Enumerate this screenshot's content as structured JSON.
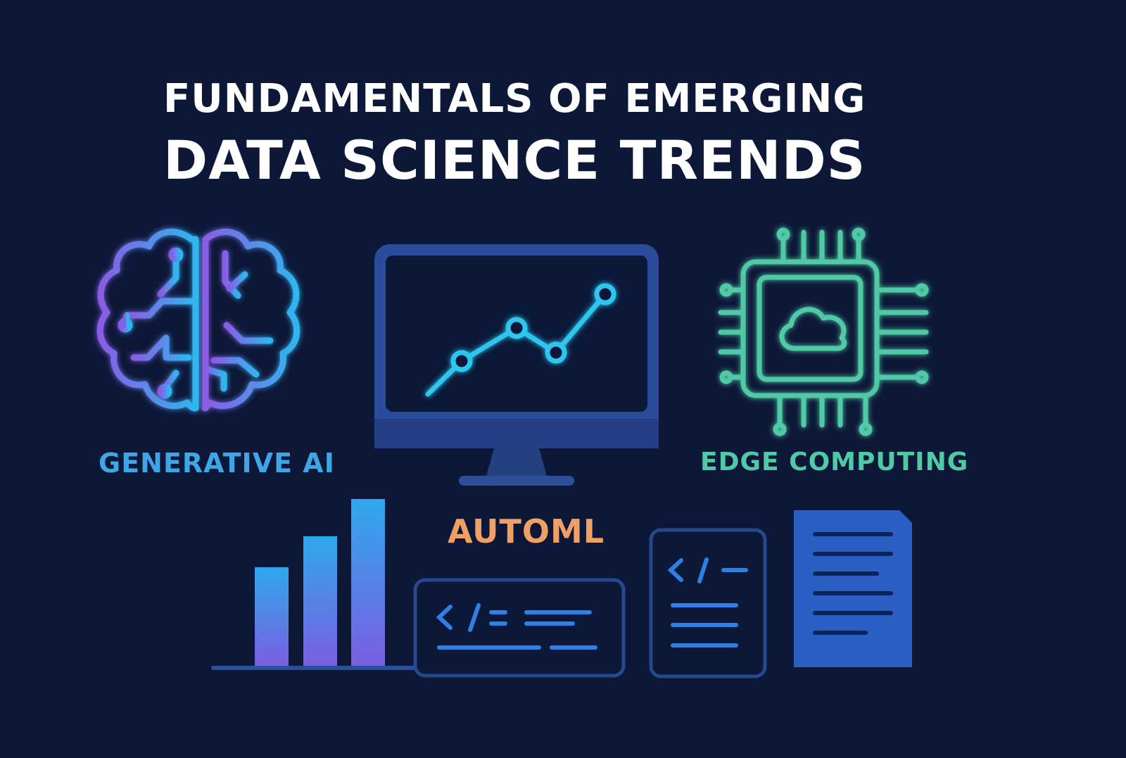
{
  "title": {
    "line1": "FUNDAMENTALS OF EMERGING",
    "line2": "DATA SCIENCE TRENDS"
  },
  "labels": {
    "generative_ai": "GENERATIVE AI",
    "edge_computing": "EDGE COMPUTING",
    "automl": "AUTOML"
  },
  "code_glyphs": {
    "panel": "</=",
    "doc": "</"
  },
  "icons": [
    "brain-circuit-icon",
    "monitor-line-chart-icon",
    "chip-cloud-icon",
    "bar-chart-icon",
    "code-panel-icon",
    "code-document-icon",
    "text-document-icon"
  ],
  "colors": {
    "background": "#0d1838",
    "generative_ai": "#3fa6e6",
    "edge_computing": "#4fc9a6",
    "automl": "#f0a062",
    "accent_blue": "#2f6fd6"
  }
}
